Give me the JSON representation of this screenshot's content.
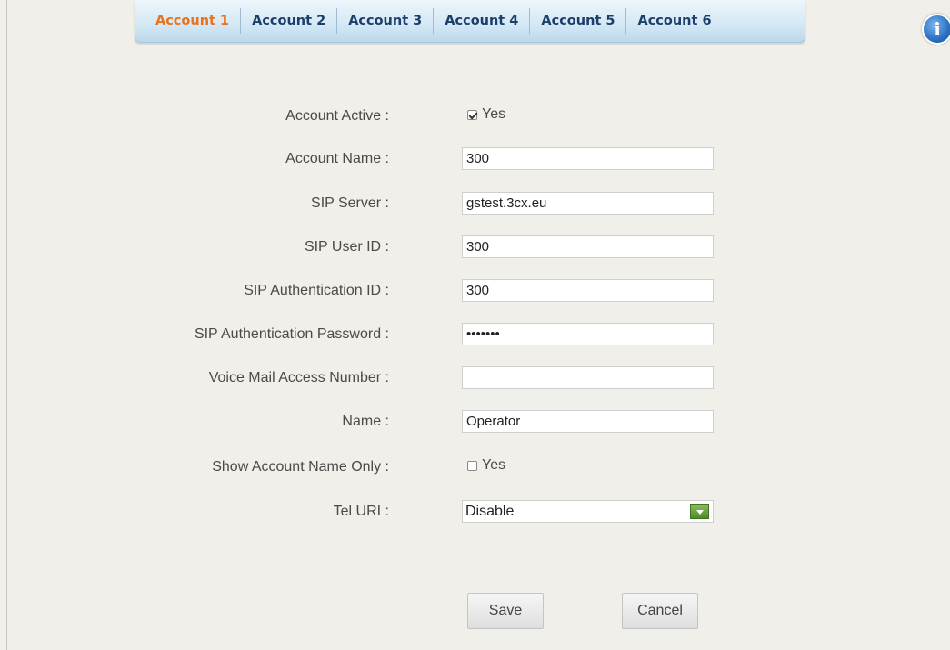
{
  "tabs": [
    "Account 1",
    "Account 2",
    "Account 3",
    "Account 4",
    "Account 5",
    "Account 6"
  ],
  "active_tab": "Account 1",
  "info_icon": "i",
  "form": {
    "account_active": {
      "label": "Account Active :",
      "checked": true,
      "text": "Yes"
    },
    "account_name": {
      "label": "Account Name :",
      "value": "300"
    },
    "sip_server": {
      "label": "SIP Server :",
      "value": "gstest.3cx.eu"
    },
    "sip_user_id": {
      "label": "SIP User ID :",
      "value": "300"
    },
    "sip_auth_id": {
      "label": "SIP Authentication ID :",
      "value": "300"
    },
    "sip_auth_password": {
      "label": "SIP Authentication Password :",
      "value": "•••••••"
    },
    "voicemail_number": {
      "label": "Voice Mail Access Number :",
      "value": ""
    },
    "name": {
      "label": "Name :",
      "value": "Operator"
    },
    "show_account_name_only": {
      "label": "Show Account Name Only :",
      "checked": false,
      "text": "Yes"
    },
    "tel_uri": {
      "label": "Tel URI :",
      "value": "Disable"
    }
  },
  "buttons": {
    "save": "Save",
    "cancel": "Cancel"
  },
  "colors": {
    "active_tab": "#e8731c",
    "tab_text": "#1b3f6b",
    "select_arrow": "#4f8a2a"
  }
}
